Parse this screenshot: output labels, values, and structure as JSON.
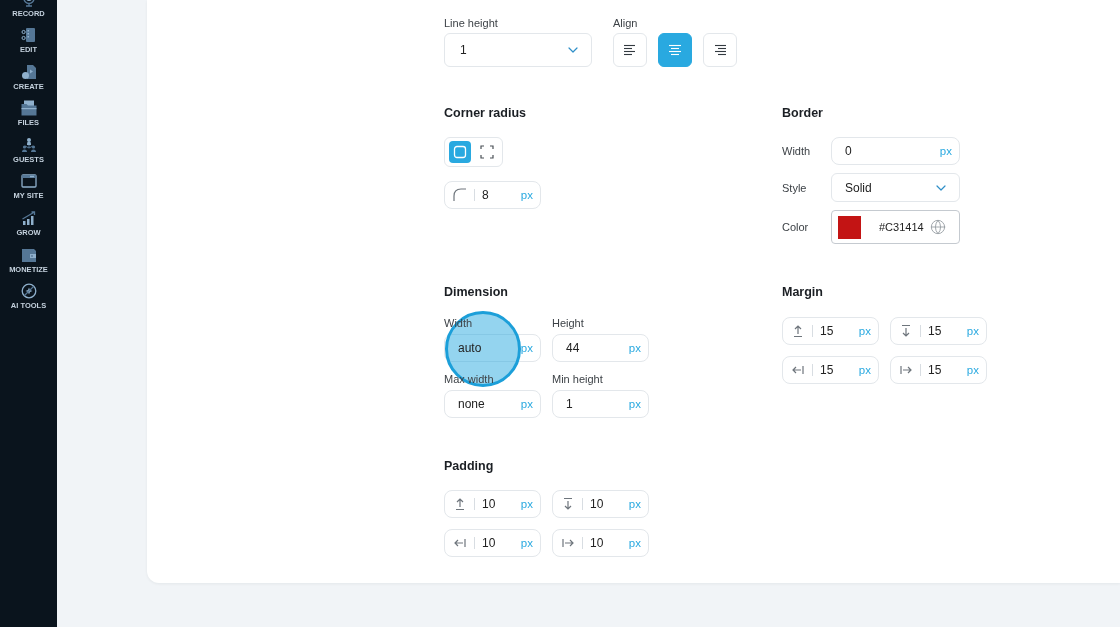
{
  "sidebar": {
    "items": [
      {
        "kind": "record",
        "label": "RECORD"
      },
      {
        "kind": "edit",
        "label": "EDIT"
      },
      {
        "kind": "create",
        "label": "CREATE"
      },
      {
        "kind": "files",
        "label": "FILES"
      },
      {
        "kind": "guests",
        "label": "GUESTS"
      },
      {
        "kind": "site",
        "label": "MY SITE"
      },
      {
        "kind": "grow",
        "label": "GROW"
      },
      {
        "kind": "monetize",
        "label": "MONETIZE"
      },
      {
        "kind": "ai",
        "label": "AI TOOLS"
      }
    ]
  },
  "text": {
    "line_height": {
      "label": "Line height",
      "value": "1"
    },
    "align": {
      "label": "Align",
      "options": [
        {
          "kind": "left",
          "selected": false
        },
        {
          "kind": "center",
          "selected": true
        },
        {
          "kind": "right",
          "selected": false
        }
      ]
    }
  },
  "corner_radius": {
    "title": "Corner radius",
    "modes": [
      {
        "kind": "all",
        "selected": true
      },
      {
        "kind": "each",
        "selected": false
      }
    ],
    "value": "8",
    "unit": "px"
  },
  "border": {
    "title": "Border",
    "width": {
      "label": "Width",
      "value": "0",
      "unit": "px"
    },
    "style": {
      "label": "Style",
      "value": "Solid"
    },
    "color": {
      "label": "Color",
      "value": "#C31414",
      "color": "#c31414"
    }
  },
  "dimension": {
    "title": "Dimension",
    "fields": [
      {
        "label": "Width",
        "value": "auto",
        "unit": "px",
        "clicked": true
      },
      {
        "label": "Height",
        "value": "44",
        "unit": "px",
        "clicked": false
      },
      {
        "label": "Max width",
        "value": "none",
        "unit": "px",
        "clicked": false
      },
      {
        "label": "Min height",
        "value": "1",
        "unit": "px",
        "clicked": false
      }
    ]
  },
  "margin": {
    "title": "Margin",
    "fields": [
      {
        "kind": "top",
        "value": "15",
        "unit": "px"
      },
      {
        "kind": "bottom",
        "value": "15",
        "unit": "px"
      },
      {
        "kind": "left",
        "value": "15",
        "unit": "px"
      },
      {
        "kind": "right",
        "value": "15",
        "unit": "px"
      }
    ]
  },
  "padding": {
    "title": "Padding",
    "fields": [
      {
        "kind": "top",
        "value": "10",
        "unit": "px"
      },
      {
        "kind": "bottom",
        "value": "10",
        "unit": "px"
      },
      {
        "kind": "left",
        "value": "10",
        "unit": "px"
      },
      {
        "kind": "right",
        "value": "10",
        "unit": "px"
      }
    ]
  }
}
